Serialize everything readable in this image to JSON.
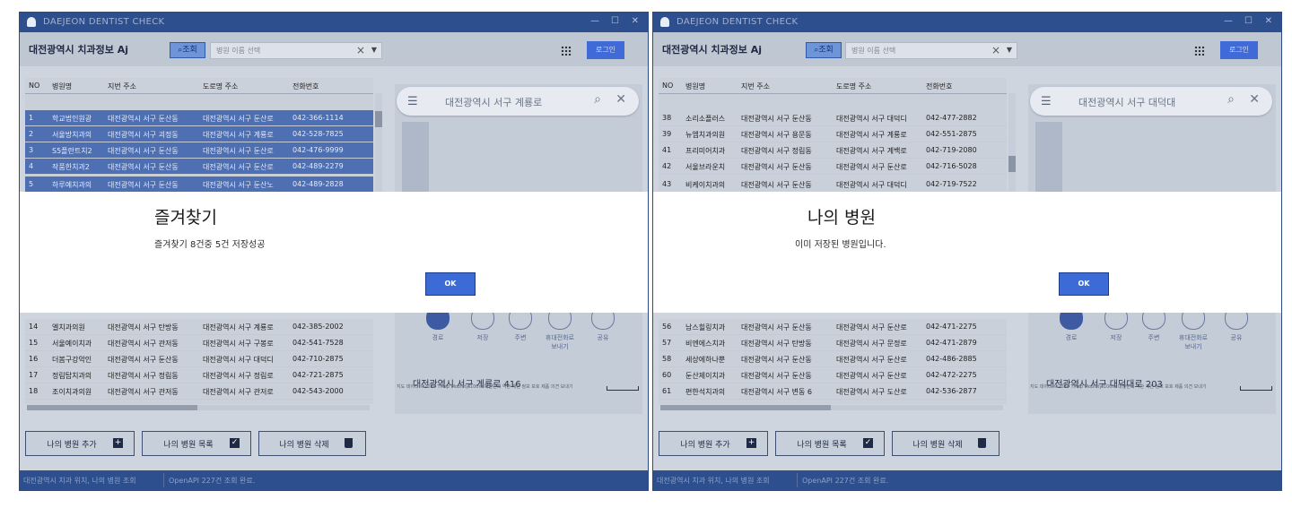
{
  "colors": {
    "titlebar": "#2d4f8e",
    "accent": "#3d6bd5",
    "selected_row": "#4e6fb2"
  },
  "window1": {
    "title": "DAEJEON DENTIST CHECK",
    "controls": {
      "minimize": "—",
      "maximize": "☐",
      "close": "✕"
    },
    "app_title": "대전광역시 치과정보 Aj",
    "search_button": "조회",
    "combo_placeholder": "병원 이름 선택",
    "login": "로그인",
    "columns": [
      "NO",
      "병원명",
      "지번 주소",
      "도로명 주소",
      "전화번호"
    ],
    "rows_top": [
      {
        "no": "1",
        "name": "학교법인원광",
        "addr": "대전광역시 서구 둔산동",
        "road": "대전광역시 서구 둔산로",
        "phone": "042-366-1114"
      },
      {
        "no": "2",
        "name": "서울방치과의",
        "addr": "대전광역시 서구 괴정동",
        "road": "대전광역시 서구 계룡로",
        "phone": "042-528-7825"
      },
      {
        "no": "3",
        "name": "S5플란트치2",
        "addr": "대전광역시 서구 둔산동",
        "road": "대전광역시 서구 둔산로",
        "phone": "042-476-9999"
      },
      {
        "no": "4",
        "name": "작품한치과2",
        "addr": "대전광역시 서구 둔산동",
        "road": "대전광역시 서구 둔산로",
        "phone": "042-489-2279"
      },
      {
        "no": "5",
        "name": "하루예치과의",
        "addr": "대전광역시 서구 둔산동",
        "road": "대전광역시 서구 둔산노",
        "phone": "042-489-2828"
      }
    ],
    "rows_bottom": [
      {
        "no": "14",
        "name": "엘치과의원",
        "addr": "대전광역시 서구 탄방동",
        "road": "대전광역시 서구 계룡로",
        "phone": "042-385-2002"
      },
      {
        "no": "15",
        "name": "서울예이치과",
        "addr": "대전광역시 서구 관저동",
        "road": "대전광역시 서구 구봉로",
        "phone": "042-541-7528"
      },
      {
        "no": "16",
        "name": "더봄구강악인",
        "addr": "대전광역시 서구 둔산동",
        "road": "대전광역시 서구 대덕디",
        "phone": "042-710-2875"
      },
      {
        "no": "17",
        "name": "정림탑치과의",
        "addr": "대전광역시 서구 정림동",
        "road": "대전광역시 서구 정림로",
        "phone": "042-721-2875"
      },
      {
        "no": "18",
        "name": "조이치과의원",
        "addr": "대전광역시 서구 관저동",
        "road": "대전광역시 서구 관저로",
        "phone": "042-543-2000"
      }
    ],
    "map_search": "대전광역시 서구 계룡로",
    "map_actions": [
      "경로",
      "저장",
      "주변",
      "휴대전화로 보내기",
      "공유"
    ],
    "map_address": "대전광역시 서구 계룡로 416",
    "map_note": "지도 데이터 ©2024 TMap Mobility   100m  대한민국  약관  개인 정보 보호  제품 의견 보내기",
    "buttons": [
      "나의 병원 추가",
      "나의 병원 목록",
      "나의 병원 삭제"
    ],
    "status_left": "대전광역시 치과 위치, 나의 병원 조회",
    "status_right": "OpenAPI 227건 조회 완료.",
    "dialog": {
      "title": "즐겨찾기",
      "message": "즐겨찾기 8건중 5건 저장성공",
      "ok": "OK"
    }
  },
  "window2": {
    "title": "DAEJEON DENTIST CHECK",
    "controls": {
      "minimize": "—",
      "maximize": "☐",
      "close": "✕"
    },
    "app_title": "대전광역시 치과정보 Aj",
    "search_button": "조회",
    "combo_placeholder": "병원 이름 선택",
    "login": "로그인",
    "columns": [
      "NO",
      "병원명",
      "지번 주소",
      "도로명 주소",
      "전화번호"
    ],
    "rows_top": [
      {
        "no": "38",
        "name": "소리소플러스",
        "addr": "대전광역시 서구 둔산동",
        "road": "대전광역시 서구 대덕디",
        "phone": "042-477-2882"
      },
      {
        "no": "39",
        "name": "뉴엠치과의원",
        "addr": "대전광역시 서구 용문동",
        "road": "대전광역시 서구 계룡로",
        "phone": "042-551-2875"
      },
      {
        "no": "41",
        "name": "프리미어치과",
        "addr": "대전광역시 서구 정림동",
        "road": "대전광역시 서구 계백로",
        "phone": "042-719-2080"
      },
      {
        "no": "42",
        "name": "서울브라운치",
        "addr": "대전광역시 서구 둔산동",
        "road": "대전광역시 서구 둔산로",
        "phone": "042-716-5028"
      },
      {
        "no": "43",
        "name": "비케이치과의",
        "addr": "대전광역시 서구 둔산동",
        "road": "대전광역시 서구 대덕디",
        "phone": "042-719-7522"
      }
    ],
    "rows_bottom": [
      {
        "no": "56",
        "name": "남스힐링치과",
        "addr": "대전광역시 서구 둔산동",
        "road": "대전광역시 서구 둔산로",
        "phone": "042-471-2275"
      },
      {
        "no": "57",
        "name": "비엔에스치과",
        "addr": "대전광역시 서구 탄방동",
        "road": "대전광역시 서구 문정로",
        "phone": "042-471-2879"
      },
      {
        "no": "58",
        "name": "세상에하나뿐",
        "addr": "대전광역시 서구 둔산동",
        "road": "대전광역시 서구 둔산로",
        "phone": "042-486-2885"
      },
      {
        "no": "60",
        "name": "둔산제이치과",
        "addr": "대전광역시 서구 둔산동",
        "road": "대전광역시 서구 둔산로",
        "phone": "042-472-2275"
      },
      {
        "no": "61",
        "name": "편한석치과의",
        "addr": "대전광역시 서구 변동 6",
        "road": "대전광역시 서구 도산로",
        "phone": "042-536-2877"
      }
    ],
    "map_search": "대전광역시 서구 대덕대",
    "map_actions": [
      "경로",
      "저장",
      "주변",
      "휴대전화로 보내기",
      "공유"
    ],
    "map_address": "대전광역시 서구 대덕대로 203",
    "map_note": "지도 데이터 ©2024 TMap Mobility   100m  대한민국  약관  개인 정보 보호  제품 의견 보내기",
    "buttons": [
      "나의 병원 추가",
      "나의 병원 목록",
      "나의 병원 삭제"
    ],
    "status_left": "대전광역시 치과 위치, 나의 병원 조회",
    "status_right": "OpenAPI 227건 조회 완료.",
    "dialog": {
      "title": "나의 병원",
      "message": "이미 저장된 병원입니다.",
      "ok": "OK"
    }
  }
}
